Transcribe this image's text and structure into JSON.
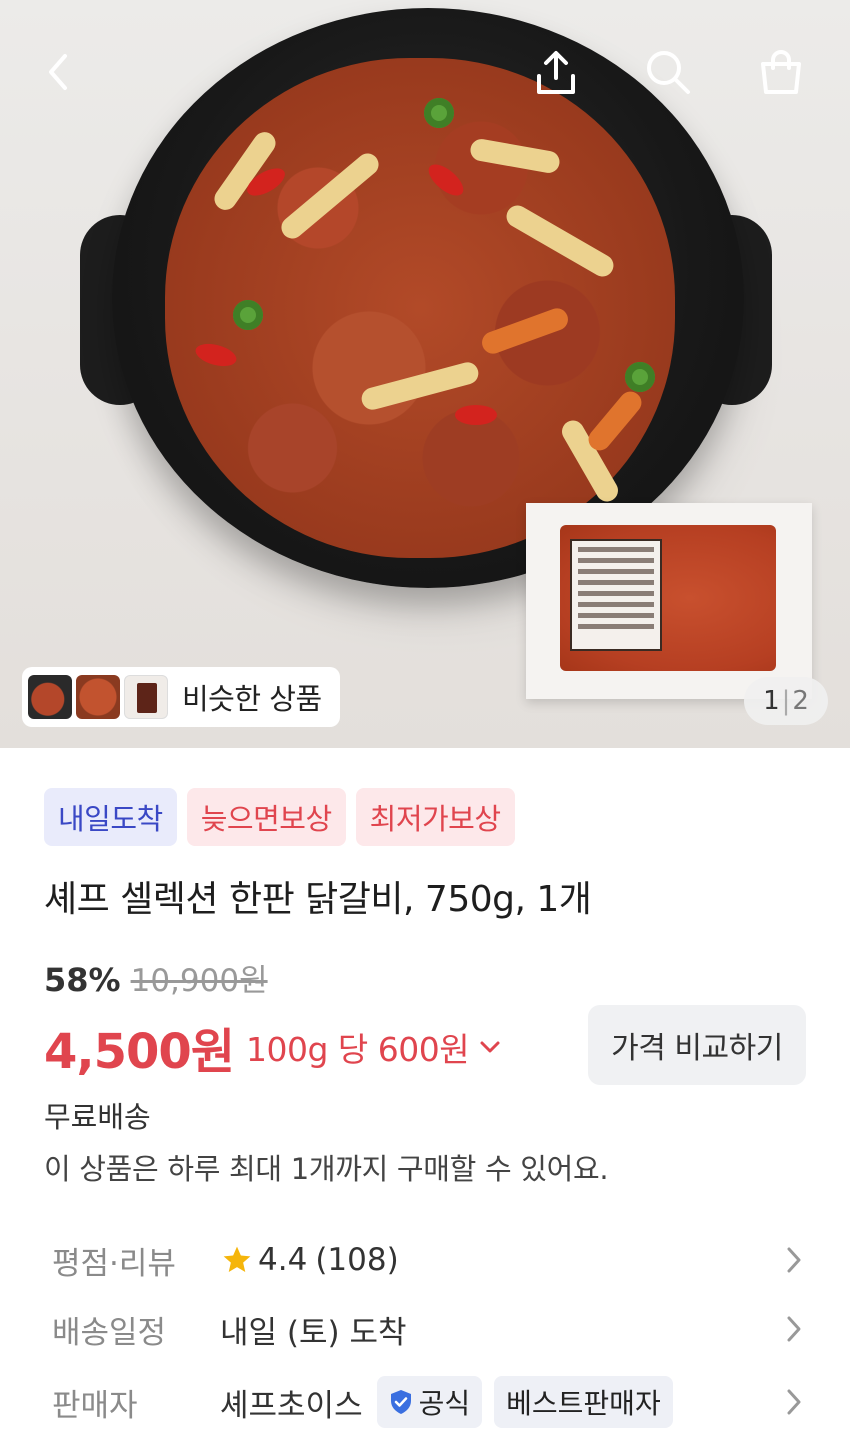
{
  "header": {
    "back_icon": "chevron-left-icon",
    "share_icon": "share-icon",
    "search_icon": "search-icon",
    "cart_icon": "shopping-bag-icon"
  },
  "gallery": {
    "similar_label": "비슷한 상품",
    "current_page": "1",
    "separator": "|",
    "total_pages": "2"
  },
  "badges": [
    {
      "label": "내일도착",
      "color": "#3a48c5"
    },
    {
      "label": "늦으면보상",
      "color": "#e0454e"
    },
    {
      "label": "최저가보상",
      "color": "#e0454e"
    }
  ],
  "product": {
    "title": "셰프 셀렉션 한판 닭갈비, 750g, 1개",
    "discount": "58%",
    "original_price": "10,900원",
    "price": "4,500원",
    "unit_price": "100g 당 600원",
    "compare_button": "가격 비교하기",
    "shipping": "무료배송",
    "limit_notice": "이 상품은 하루 최대 1개까지 구매할 수 있어요."
  },
  "info": {
    "rating_label": "평점·리뷰",
    "rating_value": "4.4",
    "review_count": "(108)",
    "delivery_label": "배송일정",
    "delivery_value": "내일 (토) 도착",
    "seller_label": "판매자",
    "seller_value": "셰프초이스",
    "official_badge": "공식",
    "best_seller_badge": "베스트판매자"
  },
  "colors": {
    "accent_red": "#e0454e",
    "accent_blue": "#3a48c5",
    "star": "#f5b50a"
  }
}
